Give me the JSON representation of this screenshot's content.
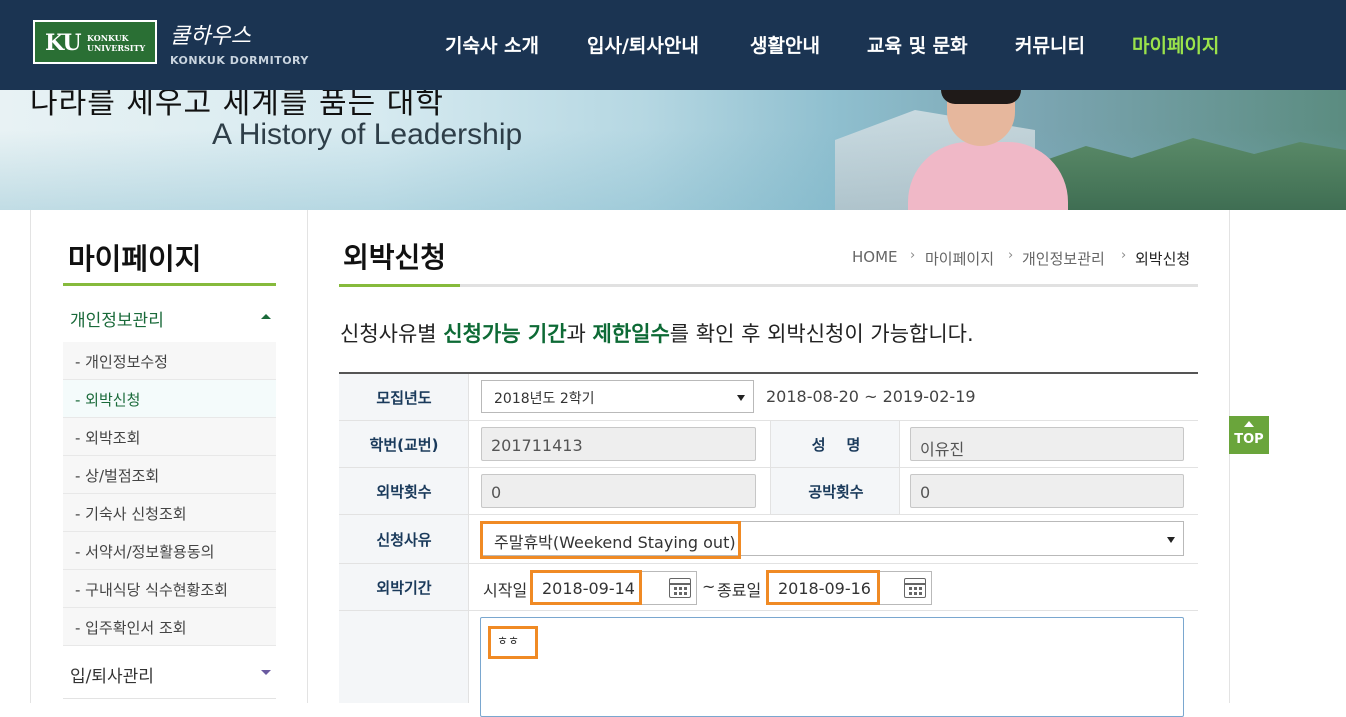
{
  "header": {
    "logo_ku": "KU",
    "logo_sub_1": "KONKUK",
    "logo_sub_2": "UNIVERSITY",
    "brand_script": "쿨하우스",
    "brand_en": "KONKUK DORMITORY",
    "nav": [
      "기숙사 소개",
      "입사/퇴사안내",
      "생활안내",
      "교육 및 문화",
      "커뮤니티",
      "마이페이지"
    ],
    "nav_active_index": 5
  },
  "banner": {
    "slogan_kr": "나라를 세우고 세계를 품는 대학",
    "slogan_en": "A History of Leadership"
  },
  "sidebar": {
    "title": "마이페이지",
    "groups": [
      {
        "label": "개인정보관리",
        "expanded": true
      },
      {
        "label": "입/퇴사관리",
        "expanded": false
      }
    ],
    "items": [
      "- 개인정보수정",
      "- 외박신청",
      "- 외박조회",
      "- 상/벌점조회",
      "- 기숙사 신청조회",
      "- 서약서/정보활용동의",
      "- 구내식당 식수현황조회",
      "- 입주확인서 조회"
    ],
    "active_item_index": 1
  },
  "main": {
    "title": "외박신청",
    "breadcrumb": [
      "HOME",
      "마이페이지",
      "개인정보관리",
      "외박신청"
    ],
    "notice_1": "신청사유별 ",
    "notice_hl_1": "신청가능 기간",
    "notice_2": "과 ",
    "notice_hl_2": "제한일수",
    "notice_3": "를 확인 후 외박신청이 가능합니다."
  },
  "form": {
    "year_label": "모집년도",
    "year_value": "2018년도 2학기",
    "year_period": "2018-08-20 ~ 2019-02-19",
    "student_id_label": "학번(교번)",
    "student_id_value": "201711413",
    "name_label": "성    명",
    "name_value": "이유진",
    "outing_count_label": "외박횟수",
    "outing_count_value": "0",
    "official_count_label": "공박횟수",
    "official_count_value": "0",
    "reason_label": "신청사유",
    "reason_value": "주말휴박(Weekend Staying out)",
    "period_label": "외박기간",
    "start_label": "시작일",
    "start_value": "2018-09-14",
    "tilde": "~",
    "end_label": "종료일",
    "end_value": "2018-09-16",
    "memo_value": "ㅎㅎ"
  },
  "top_button": "TOP",
  "colors": {
    "header_bg": "#1b3452",
    "nav_active": "#9be34b",
    "accent_green": "#86ba3c",
    "highlight_orange": "#f08a24",
    "label_navy": "#1a3a5b",
    "notice_green": "#0d6a35"
  }
}
